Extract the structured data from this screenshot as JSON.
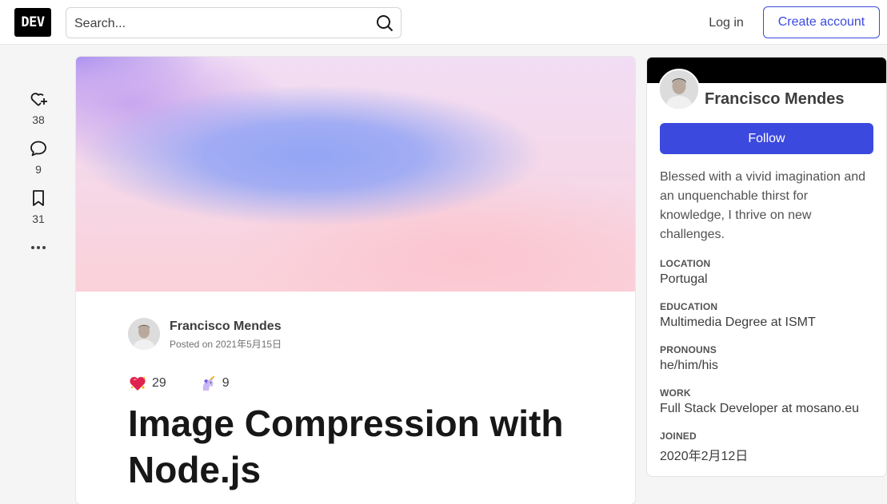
{
  "header": {
    "logo_text": "DEV",
    "search_placeholder": "Search...",
    "login_label": "Log in",
    "create_account_label": "Create account"
  },
  "actions": {
    "like_count": "38",
    "comment_count": "9",
    "bookmark_count": "31"
  },
  "article": {
    "author_name": "Francisco Mendes",
    "posted_date": "Posted on 2021年5月15日",
    "reactions": [
      {
        "icon": "heart-sparkle-icon",
        "count": "29"
      },
      {
        "icon": "unicorn-icon",
        "count": "9"
      }
    ],
    "title": "Image Compression with Node.js"
  },
  "sidebar": {
    "name": "Francisco Mendes",
    "follow_label": "Follow",
    "bio": "Blessed with a vivid imagination and an unquenchable thirst for knowledge, I thrive on new challenges.",
    "fields": [
      {
        "label": "LOCATION",
        "value": "Portugal"
      },
      {
        "label": "EDUCATION",
        "value": "Multimedia Degree at ISMT"
      },
      {
        "label": "PRONOUNS",
        "value": "he/him/his"
      },
      {
        "label": "WORK",
        "value": "Full Stack Developer at mosano.eu"
      },
      {
        "label": "JOINED",
        "value": "2020年2月12日"
      }
    ]
  },
  "colors": {
    "accent": "#3b49df",
    "background": "#f5f5f5"
  }
}
